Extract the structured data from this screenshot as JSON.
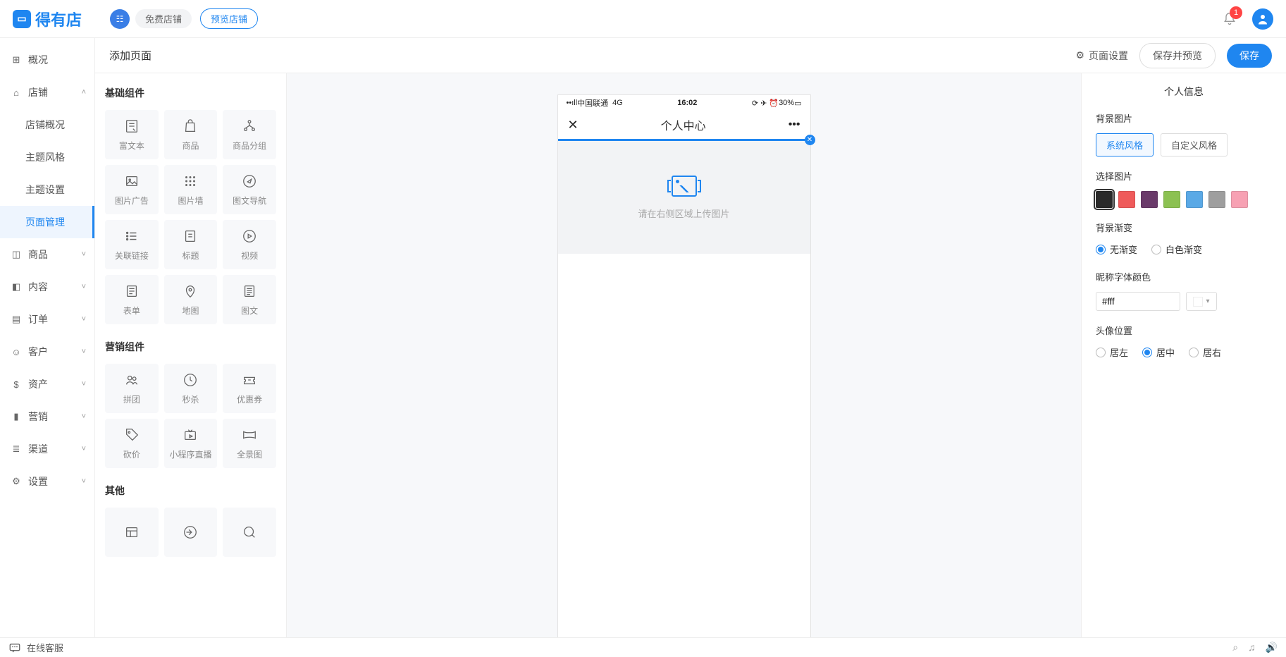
{
  "header": {
    "logo_text": "得有店",
    "free_shop": "免费店铺",
    "preview_shop": "预览店铺",
    "notification_count": "1"
  },
  "sidebar": {
    "overview": "概况",
    "shop": "店铺",
    "shop_children": {
      "shop_overview": "店铺概况",
      "theme_style": "主题风格",
      "theme_settings": "主题设置",
      "page_manage": "页面管理"
    },
    "goods": "商品",
    "content": "内容",
    "orders": "订单",
    "customers": "客户",
    "assets": "资产",
    "marketing": "营销",
    "channels": "渠道",
    "settings": "设置"
  },
  "page_header": {
    "title": "添加页面",
    "page_settings": "页面设置",
    "save_preview": "保存并预览",
    "save": "保存"
  },
  "components": {
    "section_basic": "基础组件",
    "section_marketing": "营销组件",
    "section_other": "其他",
    "basic": {
      "richtext": "富文本",
      "goods": "商品",
      "goods_group": "商品分组",
      "image_ad": "图片广告",
      "image_wall": "图片墙",
      "image_nav": "图文导航",
      "related_link": "关联链接",
      "title": "标题",
      "video": "视频",
      "form": "表单",
      "map": "地图",
      "image_text": "图文"
    },
    "marketing": {
      "group_buy": "拼团",
      "flash_sale": "秒杀",
      "coupon": "优惠券",
      "bargain": "砍价",
      "live": "小程序直播",
      "panorama": "全景图"
    }
  },
  "preview": {
    "carrier": "中国联通",
    "network": "4G",
    "time": "16:02",
    "battery": "30%",
    "nav_title": "个人中心",
    "upload_hint": "请在右侧区域上传图片"
  },
  "props": {
    "panel_title": "个人信息",
    "bg_image_label": "背景图片",
    "tab_system": "系统风格",
    "tab_custom": "自定义风格",
    "select_image_label": "选择图片",
    "colors": [
      "#2a2a2a",
      "#ef5b5b",
      "#6a3a6a",
      "#8cc152",
      "#5aa9e6",
      "#9e9e9e",
      "#f7a1b3"
    ],
    "gradient_label": "背景渐变",
    "gradient_none": "无渐变",
    "gradient_white": "白色渐变",
    "nickname_color_label": "昵称字体颜色",
    "nickname_color_value": "#fff",
    "avatar_pos_label": "头像位置",
    "pos_left": "居左",
    "pos_center": "居中",
    "pos_right": "居右"
  },
  "footer": {
    "online_support": "在线客服"
  }
}
